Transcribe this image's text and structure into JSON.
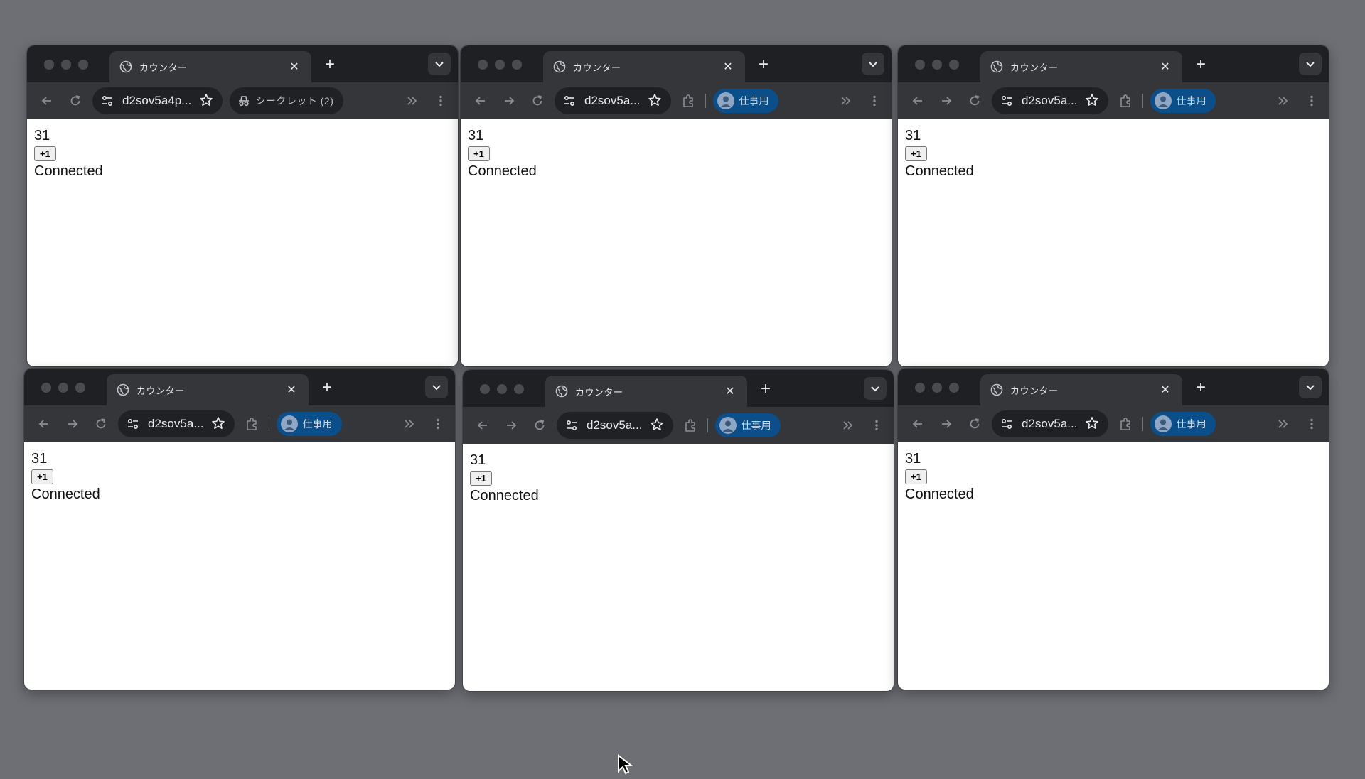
{
  "windows": [
    {
      "tab_title": "カウンター",
      "url": "d2sov5a4p...",
      "profile_label": "シークレット (2)",
      "profile_kind": "incognito",
      "show_forward": false,
      "count": "31",
      "button_label": "+1",
      "status": "Connected"
    },
    {
      "tab_title": "カウンター",
      "url": "d2sov5a...",
      "profile_label": "仕事用",
      "profile_kind": "work",
      "show_forward": true,
      "count": "31",
      "button_label": "+1",
      "status": "Connected"
    },
    {
      "tab_title": "カウンター",
      "url": "d2sov5a...",
      "profile_label": "仕事用",
      "profile_kind": "work",
      "show_forward": true,
      "count": "31",
      "button_label": "+1",
      "status": "Connected"
    },
    {
      "tab_title": "カウンター",
      "url": "d2sov5a...",
      "profile_label": "仕事用",
      "profile_kind": "work",
      "show_forward": true,
      "count": "31",
      "button_label": "+1",
      "status": "Connected"
    },
    {
      "tab_title": "カウンター",
      "url": "d2sov5a...",
      "profile_label": "仕事用",
      "profile_kind": "work",
      "show_forward": true,
      "count": "31",
      "button_label": "+1",
      "status": "Connected"
    },
    {
      "tab_title": "カウンター",
      "url": "d2sov5a...",
      "profile_label": "仕事用",
      "profile_kind": "work",
      "show_forward": true,
      "count": "31",
      "button_label": "+1",
      "status": "Connected"
    }
  ],
  "colors": {
    "desktop": "#6d6f75",
    "tabbar": "#1f2023",
    "toolbar": "#35363a",
    "profile_chip": "#0b4f8a"
  }
}
